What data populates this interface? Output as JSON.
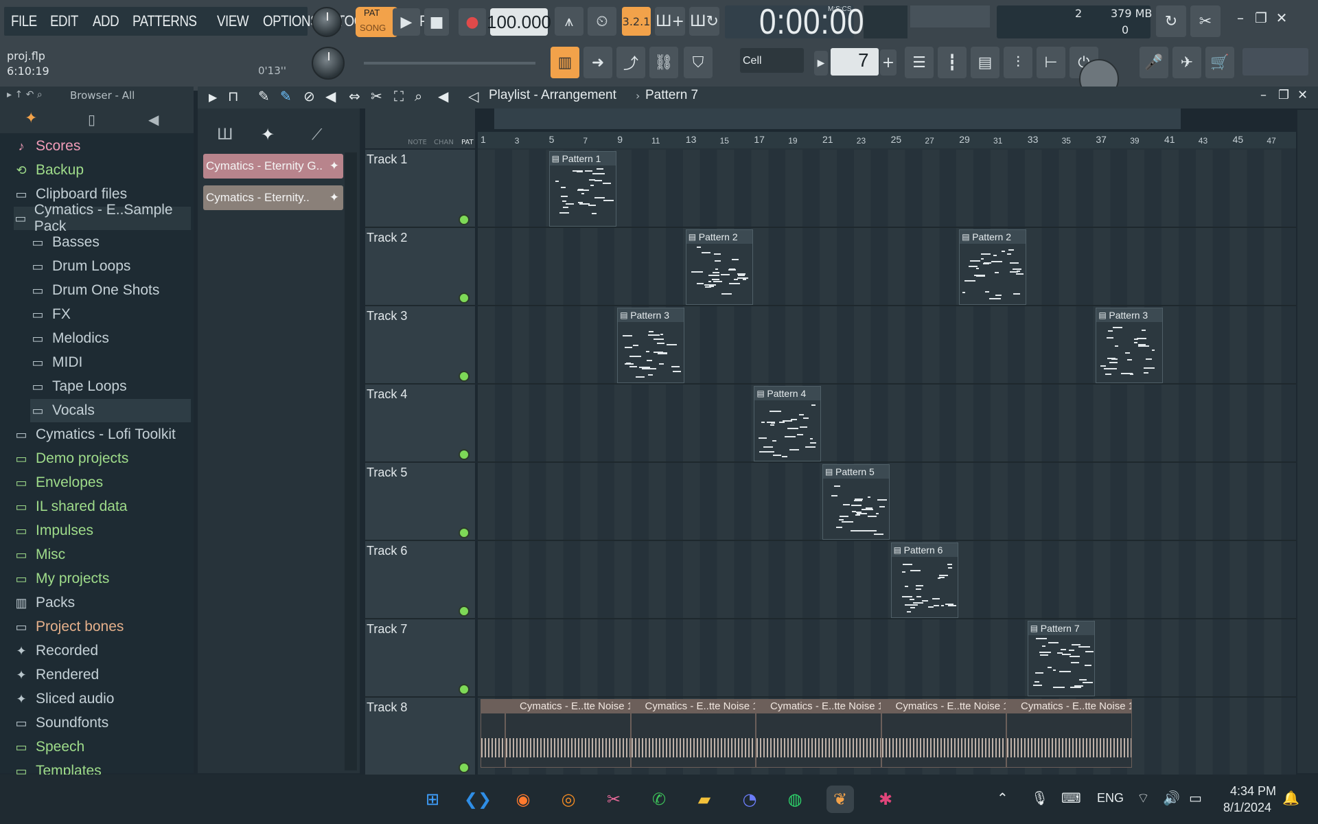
{
  "menu": [
    "FILE",
    "EDIT",
    "ADD",
    "PATTERNS",
    "VIEW",
    "OPTIONS",
    "TOOLS",
    "HELP"
  ],
  "transport": {
    "pat_label": "PAT",
    "song_label": "SONG",
    "tempo": "100.000",
    "time": "0:00:00",
    "time_unit": "M:S:CS"
  },
  "project": {
    "name": "proj.flp",
    "position": "6:10:19",
    "length": "0'13''"
  },
  "performance": {
    "cpu": "2",
    "memory": "379 MB",
    "polyphony": "0"
  },
  "snap": {
    "label": "Cell",
    "pattern_number": "7"
  },
  "browser": {
    "title": "Browser - All",
    "items": [
      {
        "label": "Scores",
        "icon": "note-icon",
        "style": "pink",
        "depth": 0
      },
      {
        "label": "Backup",
        "icon": "backup-folder-icon",
        "style": "green",
        "depth": 0
      },
      {
        "label": "Clipboard files",
        "icon": "folder-icon",
        "style": "normal",
        "depth": 0
      },
      {
        "label": "Cymatics - E..Sample Pack",
        "icon": "folder-open-icon",
        "style": "normal",
        "depth": 0
      },
      {
        "label": "Basses",
        "icon": "folder-icon",
        "style": "normal",
        "depth": 1
      },
      {
        "label": "Drum Loops",
        "icon": "folder-icon",
        "style": "normal",
        "depth": 1
      },
      {
        "label": "Drum One Shots",
        "icon": "folder-icon",
        "style": "normal",
        "depth": 1
      },
      {
        "label": "FX",
        "icon": "folder-icon",
        "style": "normal",
        "depth": 1
      },
      {
        "label": "Melodics",
        "icon": "folder-icon",
        "style": "normal",
        "depth": 1
      },
      {
        "label": "MIDI",
        "icon": "folder-icon",
        "style": "normal",
        "depth": 1
      },
      {
        "label": "Tape Loops",
        "icon": "folder-icon",
        "style": "normal",
        "depth": 1
      },
      {
        "label": "Vocals",
        "icon": "folder-icon",
        "style": "selected",
        "depth": 1
      },
      {
        "label": "Cymatics - Lofi Toolkit",
        "icon": "folder-icon",
        "style": "normal",
        "depth": 0
      },
      {
        "label": "Demo projects",
        "icon": "folder-icon",
        "style": "green",
        "depth": 0
      },
      {
        "label": "Envelopes",
        "icon": "folder-icon",
        "style": "green",
        "depth": 0
      },
      {
        "label": "IL shared data",
        "icon": "folder-icon",
        "style": "green",
        "depth": 0
      },
      {
        "label": "Impulses",
        "icon": "folder-icon",
        "style": "green",
        "depth": 0
      },
      {
        "label": "Misc",
        "icon": "folder-icon",
        "style": "green",
        "depth": 0
      },
      {
        "label": "My projects",
        "icon": "folder-icon",
        "style": "green",
        "depth": 0
      },
      {
        "label": "Packs",
        "icon": "packs-icon",
        "style": "normal",
        "depth": 0
      },
      {
        "label": "Project bones",
        "icon": "folder-icon",
        "style": "tan",
        "depth": 0
      },
      {
        "label": "Recorded",
        "icon": "wave-icon",
        "style": "normal",
        "depth": 0
      },
      {
        "label": "Rendered",
        "icon": "wave-icon",
        "style": "normal",
        "depth": 0
      },
      {
        "label": "Sliced audio",
        "icon": "wave-icon",
        "style": "normal",
        "depth": 0
      },
      {
        "label": "Soundfonts",
        "icon": "folder-icon",
        "style": "normal",
        "depth": 0
      },
      {
        "label": "Speech",
        "icon": "folder-icon",
        "style": "green",
        "depth": 0
      },
      {
        "label": "Templates",
        "icon": "folder-icon",
        "style": "green",
        "depth": 0
      }
    ]
  },
  "picker": {
    "clips": [
      {
        "label": "Cymatics - Eternity G..",
        "color": "#b8848c"
      },
      {
        "label": "Cymatics - Eternity..",
        "color": "#8a8079"
      }
    ],
    "tab_labels": [
      "NOTE",
      "CHAN",
      "PAT"
    ]
  },
  "playlist": {
    "title": "Playlist - Arrangement",
    "pattern": "Pattern 7",
    "ruler": [
      "1",
      "3",
      "5",
      "7",
      "9",
      "11",
      "13",
      "15",
      "17",
      "19",
      "21",
      "23",
      "25",
      "27",
      "29",
      "31",
      "33",
      "35",
      "37",
      "39",
      "41",
      "43",
      "45",
      "47"
    ],
    "tracks": [
      {
        "name": "Track 1"
      },
      {
        "name": "Track 2"
      },
      {
        "name": "Track 3"
      },
      {
        "name": "Track 4"
      },
      {
        "name": "Track 5"
      },
      {
        "name": "Track 6"
      },
      {
        "name": "Track 7"
      },
      {
        "name": "Track 8"
      }
    ],
    "clips": [
      {
        "label": "Pattern 1",
        "track": 1,
        "bar": 5
      },
      {
        "label": "Pattern 2",
        "track": 2,
        "bar": 13
      },
      {
        "label": "Pattern 2",
        "track": 2,
        "bar": 29
      },
      {
        "label": "Pattern 3",
        "track": 3,
        "bar": 9
      },
      {
        "label": "Pattern 3",
        "track": 3,
        "bar": 37
      },
      {
        "label": "Pattern 4",
        "track": 4,
        "bar": 17
      },
      {
        "label": "Pattern 5",
        "track": 5,
        "bar": 21
      },
      {
        "label": "Pattern 6",
        "track": 6,
        "bar": 25
      },
      {
        "label": "Pattern 7",
        "track": 7,
        "bar": 33
      }
    ],
    "audio_clips": [
      {
        "label": "Cymatics - E..tte Noise 1"
      },
      {
        "label": "Cymatics - E..tte Noise 1"
      },
      {
        "label": "Cymatics - E..tte Noise 1"
      },
      {
        "label": "Cymatics - E..tte Noise 1"
      },
      {
        "label": "Cymatics - E..tte Noise 1"
      }
    ]
  },
  "taskbar": {
    "apps": [
      "windows-start-icon",
      "vscode-icon",
      "firefox-icon",
      "blender-icon",
      "snipping-icon",
      "whatsapp-icon",
      "file-explorer-icon",
      "discord-icon",
      "spotify-icon",
      "fl-studio-icon",
      "slack-icon"
    ],
    "language": "ENG",
    "time": "4:34 PM",
    "date": "8/1/2024"
  }
}
